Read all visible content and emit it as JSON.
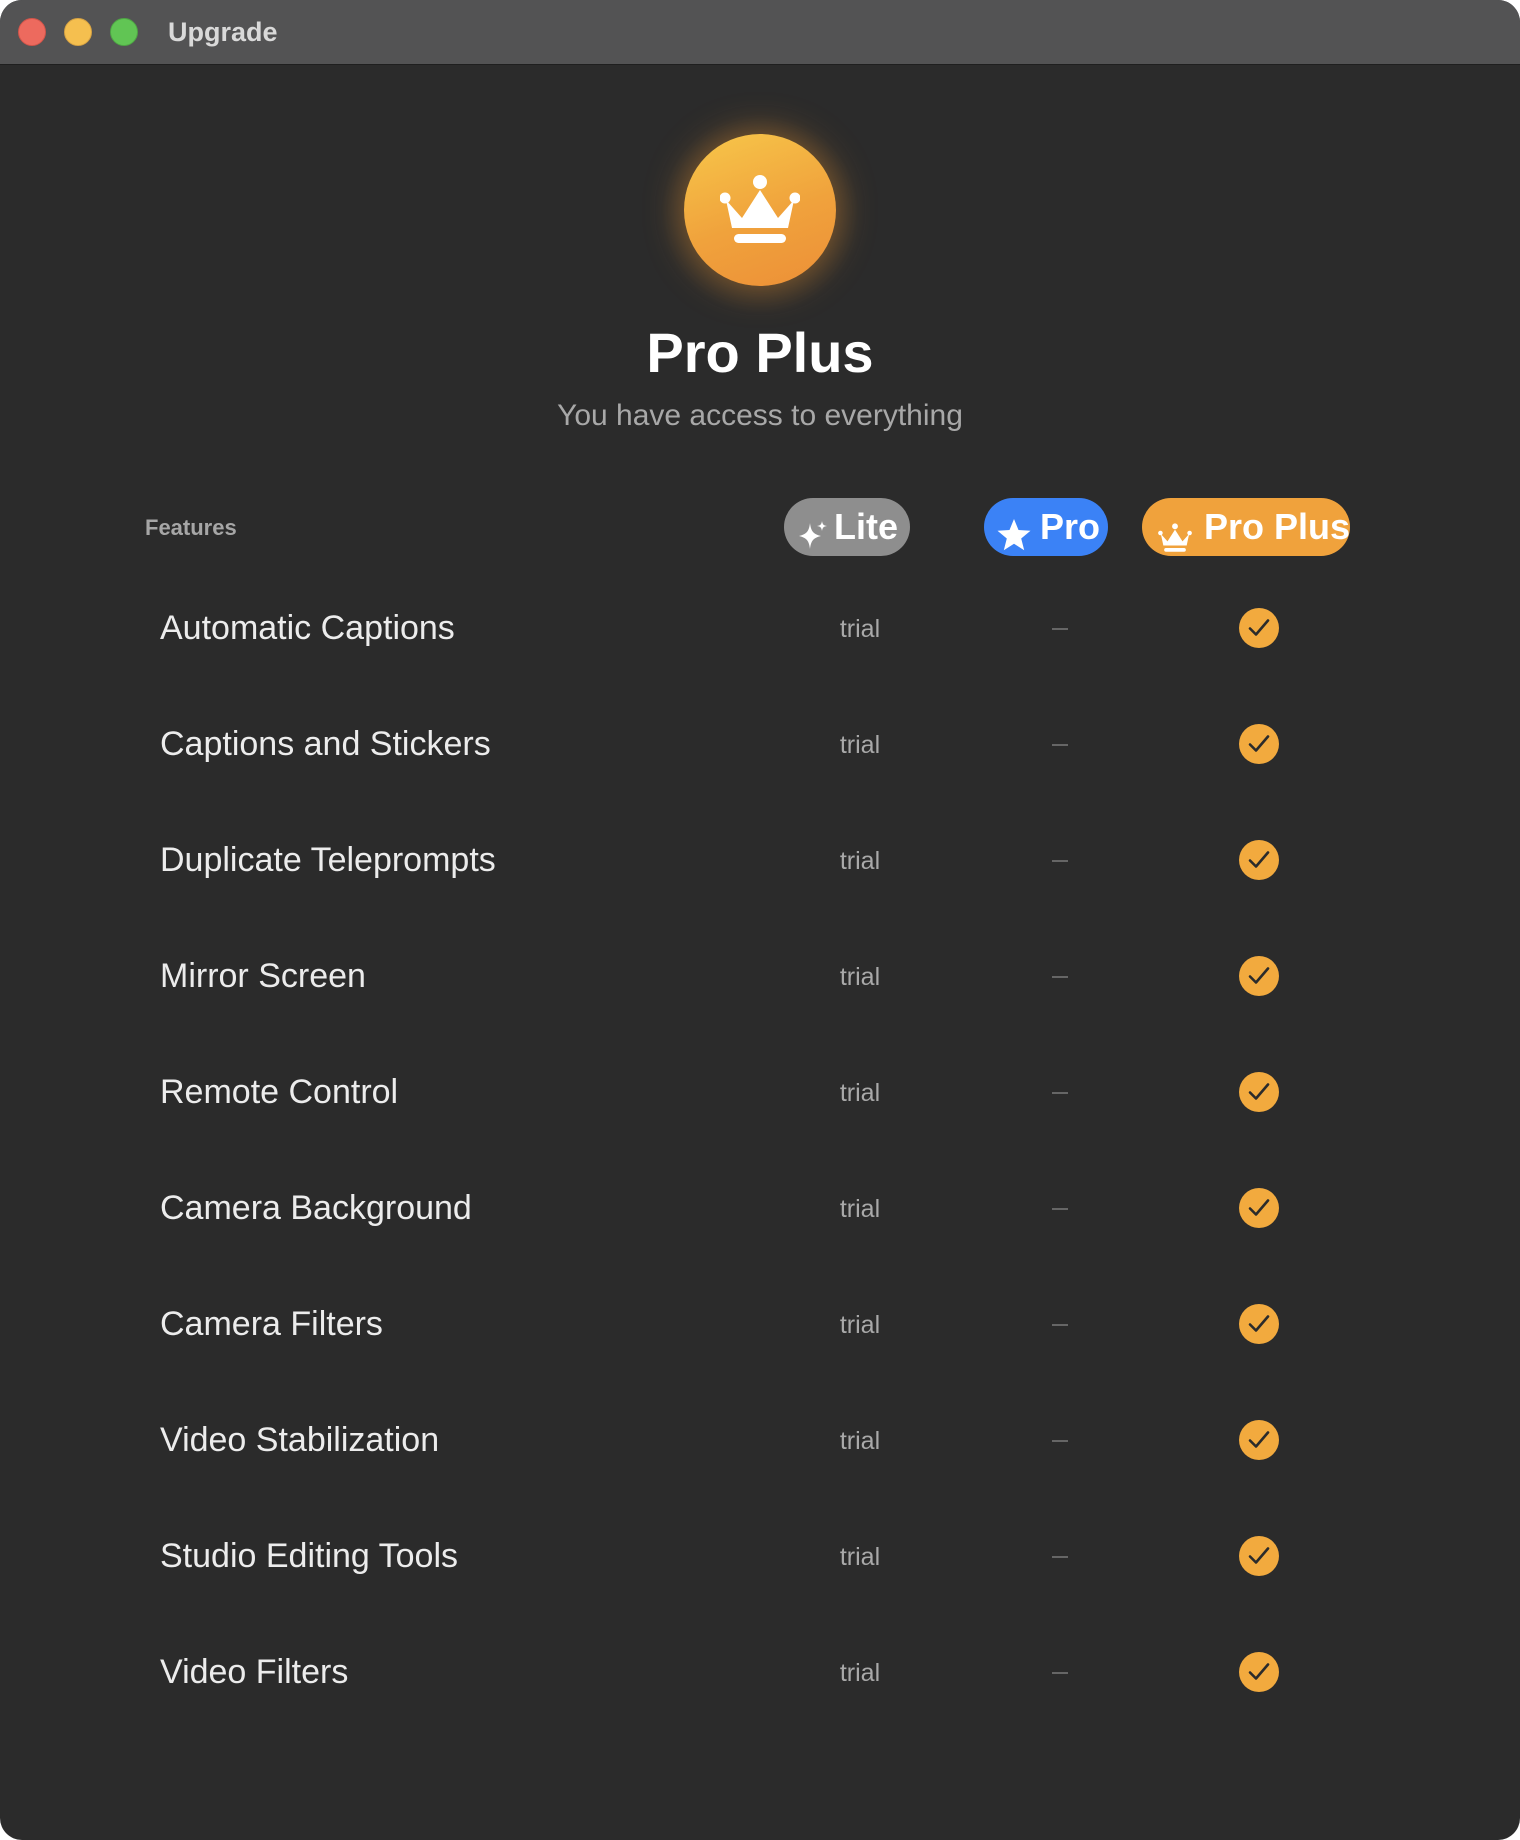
{
  "window": {
    "title": "Upgrade"
  },
  "hero": {
    "icon": "crown-icon",
    "title": "Pro Plus",
    "subtitle": "You have access to everything"
  },
  "table": {
    "features_label": "Features",
    "tiers": [
      {
        "label": "Lite",
        "icon": "sparkles-icon",
        "color": "#8e8e8e"
      },
      {
        "label": "Pro",
        "icon": "star-icon",
        "color": "#3b82f6"
      },
      {
        "label": "Pro Plus",
        "icon": "crown-icon",
        "color": "#f0a23c"
      }
    ],
    "rows": [
      {
        "feature": "Automatic Captions",
        "lite": "trial",
        "pro": "–",
        "pro_plus": "check"
      },
      {
        "feature": "Captions and Stickers",
        "lite": "trial",
        "pro": "–",
        "pro_plus": "check"
      },
      {
        "feature": "Duplicate Teleprompts",
        "lite": "trial",
        "pro": "–",
        "pro_plus": "check"
      },
      {
        "feature": "Mirror Screen",
        "lite": "trial",
        "pro": "–",
        "pro_plus": "check"
      },
      {
        "feature": "Remote Control",
        "lite": "trial",
        "pro": "–",
        "pro_plus": "check"
      },
      {
        "feature": "Camera Background",
        "lite": "trial",
        "pro": "–",
        "pro_plus": "check"
      },
      {
        "feature": "Camera Filters",
        "lite": "trial",
        "pro": "–",
        "pro_plus": "check"
      },
      {
        "feature": "Video Stabilization",
        "lite": "trial",
        "pro": "–",
        "pro_plus": "check"
      },
      {
        "feature": "Studio Editing Tools",
        "lite": "trial",
        "pro": "–",
        "pro_plus": "check"
      },
      {
        "feature": "Video Filters",
        "lite": "trial",
        "pro": "–",
        "pro_plus": "check"
      }
    ]
  },
  "colors": {
    "accent": "#f0a23c",
    "pro_blue": "#3b82f6",
    "background": "#2b2b2b"
  }
}
